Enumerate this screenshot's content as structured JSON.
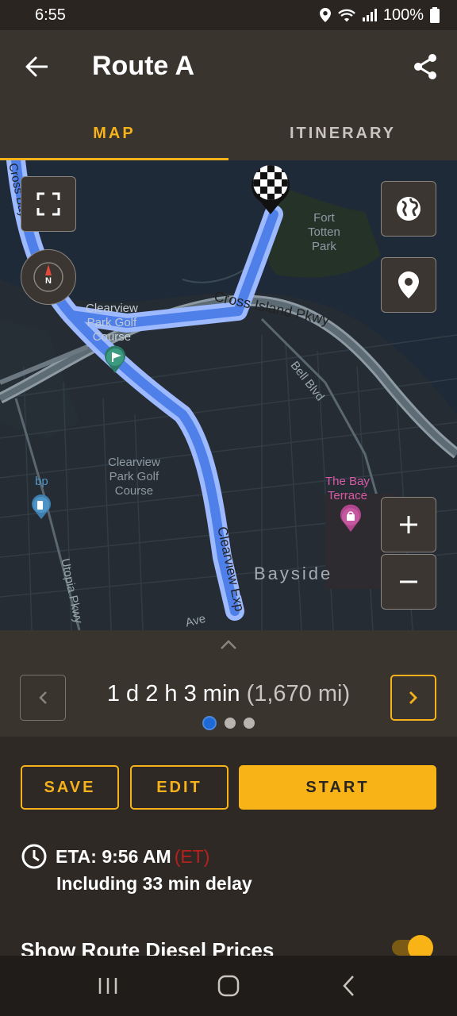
{
  "status": {
    "time": "6:55",
    "battery": "100%"
  },
  "header": {
    "title": "Route A"
  },
  "tabs": [
    {
      "label": "MAP"
    },
    {
      "label": "ITINERARY"
    }
  ],
  "map": {
    "labels": {
      "fort_totten": "Fort\nTotten\nPark",
      "cross_island": "Cross Island Pkwy",
      "golf_top": "Clearview\nPark Golf\nCourse",
      "golf_bottom": "Clearview\nPark Golf\nCourse",
      "bell_blvd": "Bell Blvd",
      "bay_terrace": "The Bay\nTerrace",
      "bp": "bp",
      "bayside": "Bayside",
      "utopia": "Utopia Pkwy",
      "clearview_exp": "Clearview Exp",
      "ave": "Ave",
      "cross_bay": "Cross Bay"
    }
  },
  "route": {
    "time": "1 d 2 h 3 min",
    "distance": "(1,670 mi)",
    "page_count": 3,
    "active_index": 0
  },
  "actions": {
    "save": "SAVE",
    "edit": "EDIT",
    "start": "START"
  },
  "eta": {
    "label": "ETA: 9:56 AM",
    "timezone": "(ET)",
    "delay": "Including 33 min delay"
  },
  "diesel": {
    "label": "Show Route Diesel Prices",
    "enabled": true
  },
  "colors": {
    "accent": "#f5b21a",
    "route": "#4f7fe8",
    "timezone": "#b8201c"
  }
}
